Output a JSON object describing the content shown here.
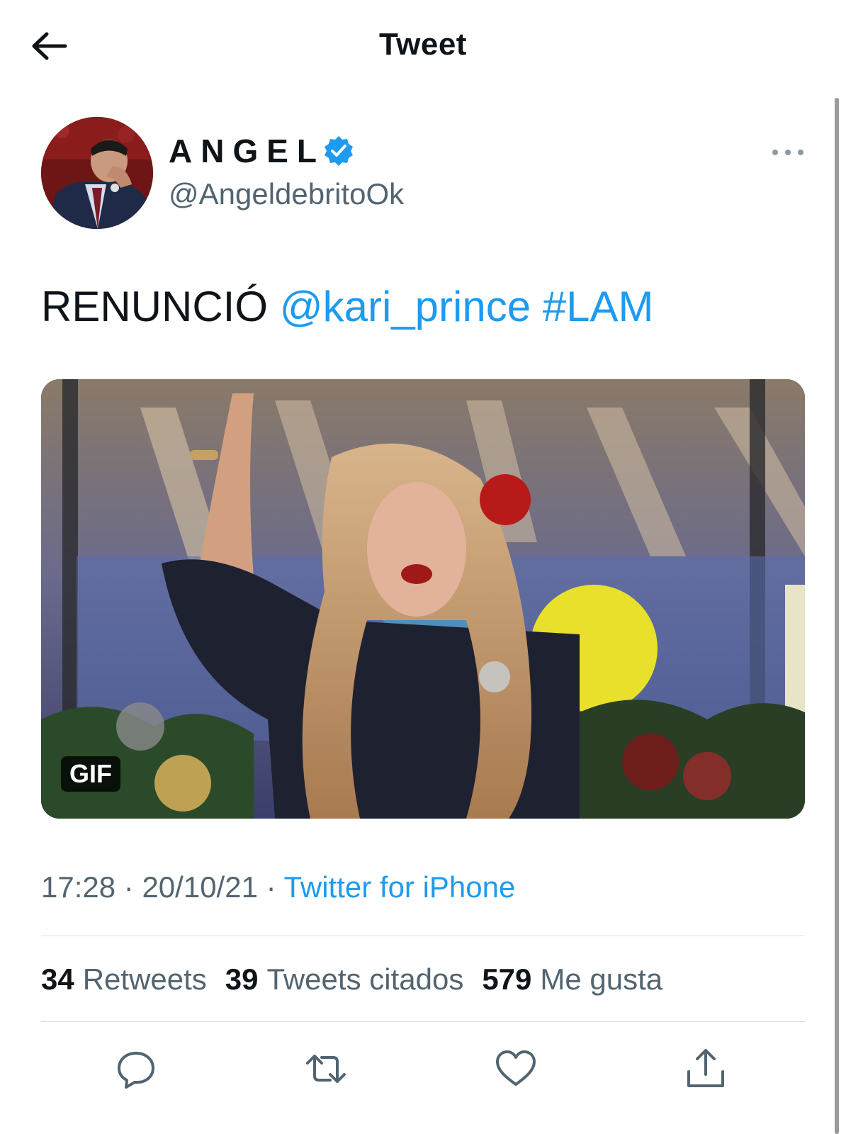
{
  "header": {
    "title": "Tweet",
    "back_icon": "arrow-left-icon"
  },
  "author": {
    "display_name": "ANGEL",
    "handle": "@AngeldebritoOk",
    "verified": true,
    "verified_color": "#1d9bf0"
  },
  "tweet": {
    "text_plain": "RENUNCIÓ",
    "mention": "@kari_prince",
    "hashtag": "#LAM"
  },
  "media": {
    "badge": "GIF"
  },
  "meta": {
    "time": "17:28",
    "date": "20/10/21",
    "separator": "·",
    "source": "Twitter for iPhone"
  },
  "stats": {
    "retweets_count": "34",
    "retweets_label": "Retweets",
    "quotes_count": "39",
    "quotes_label": "Tweets citados",
    "likes_count": "579",
    "likes_label": "Me gusta"
  },
  "actions": [
    "reply-icon",
    "retweet-icon",
    "like-icon",
    "share-icon"
  ],
  "colors": {
    "accent": "#1d9bf0",
    "text": "#0f1419",
    "secondary": "#536471"
  }
}
